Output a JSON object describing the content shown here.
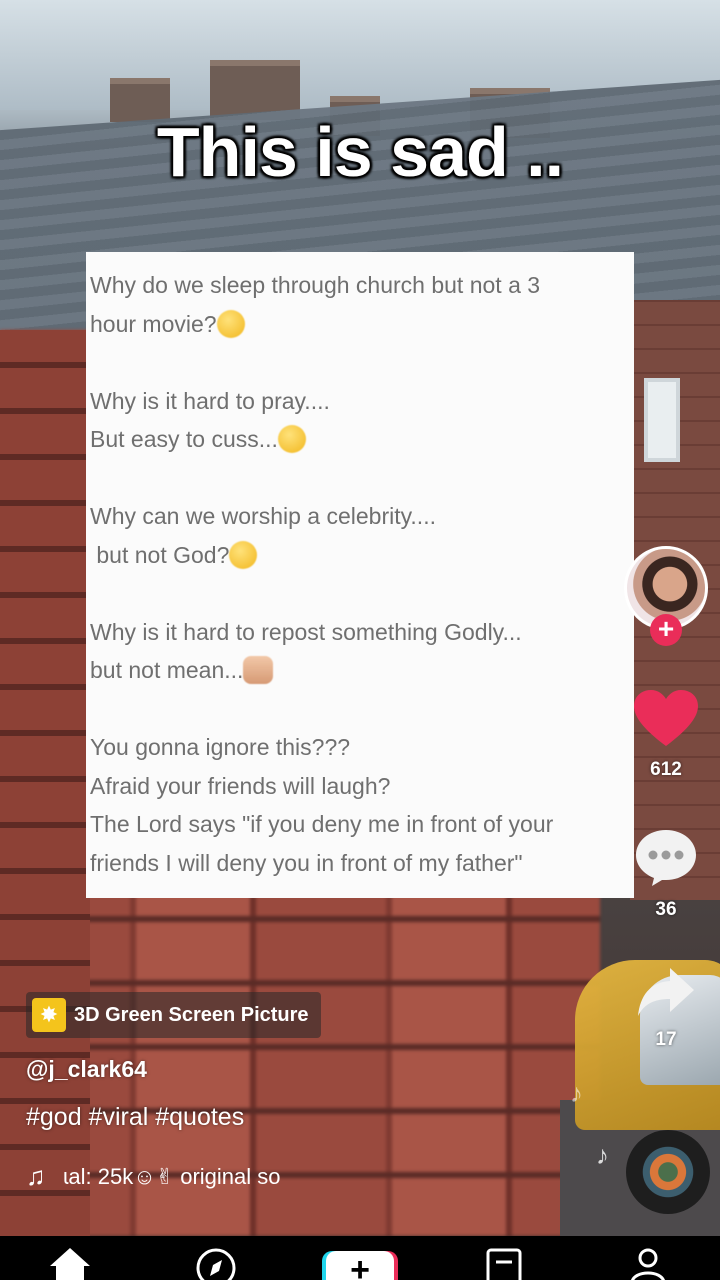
{
  "video": {
    "headline": "This is sad ..",
    "note_lines": [
      "Why do we sleep through church but not a 3",
      "hour movie?",
      "",
      "Why is it hard to pray....",
      "But easy to cuss...",
      "",
      "Why can we worship a celebrity....",
      " but not God?",
      "",
      "Why is it hard to repost something Godly...",
      "but not mean...",
      "",
      "You gonna ignore this???",
      "Afraid your friends will laugh?",
      "The Lord says \"if you deny me in front of your",
      "friends I will deny you in front of my father\""
    ]
  },
  "rail": {
    "follow_symbol": "+",
    "likes": "612",
    "comments": "36",
    "shares": "17",
    "like_color": "#ea2d59"
  },
  "info": {
    "effect_label": "3D Green Screen Picture",
    "username": "@j_clark64",
    "caption": "#god #viral #quotes",
    "sound_text": "ɩal: 25k☺✌    original so"
  },
  "nav": {
    "create_symbol": "+",
    "icons": [
      "home-icon",
      "discover-icon",
      "create-icon",
      "inbox-icon",
      "profile-icon"
    ]
  }
}
